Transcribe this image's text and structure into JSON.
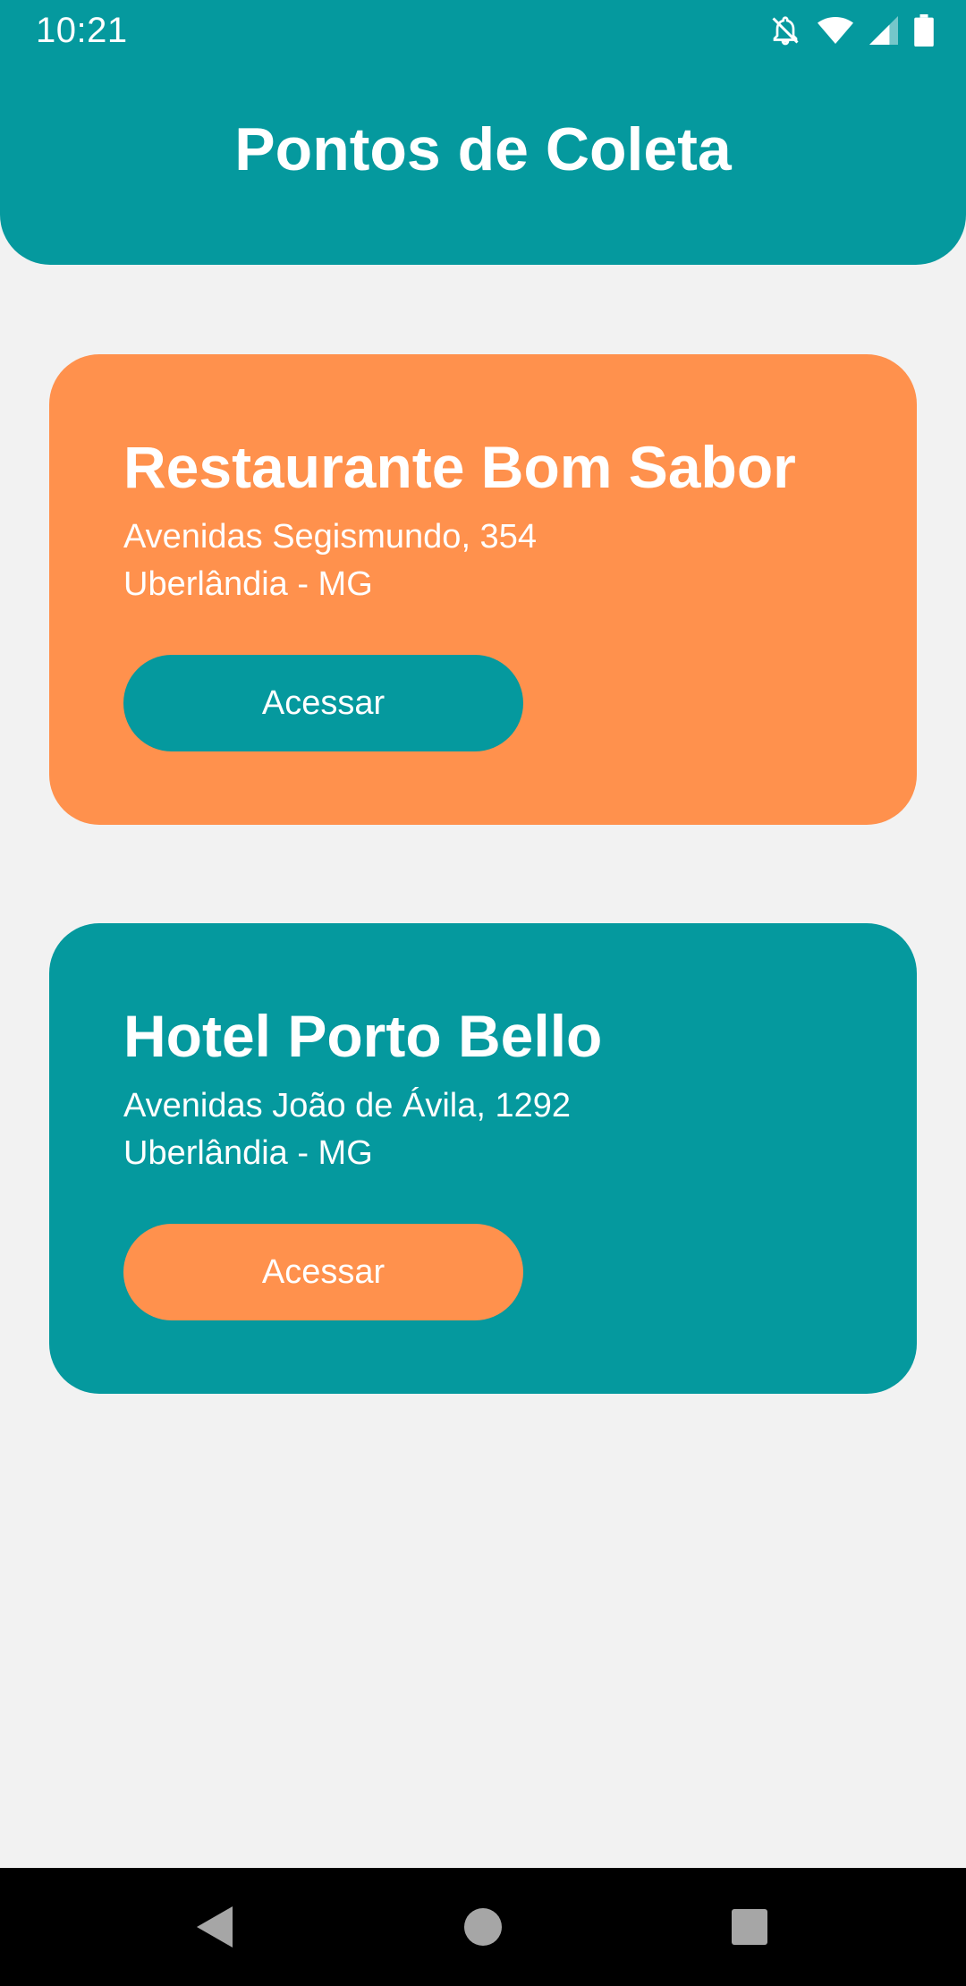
{
  "status_bar": {
    "time": "10:21",
    "icons": [
      "notifications-off-icon",
      "wifi-icon",
      "cellular-signal-icon",
      "battery-icon"
    ]
  },
  "header": {
    "title": "Pontos de Coleta",
    "background_color": "#05999e"
  },
  "collection_points": [
    {
      "name": "Restaurante Bom Sabor",
      "address_line1": "Avenidas Segismundo, 354",
      "address_line2": "Uberlândia - MG",
      "button_label": "Acessar",
      "card_color": "#ff914d",
      "button_color": "#05999e"
    },
    {
      "name": "Hotel Porto Bello",
      "address_line1": "Avenidas João de Ávila, 1292",
      "address_line2": "Uberlândia - MG",
      "button_label": "Acessar",
      "card_color": "#05999e",
      "button_color": "#ff914d"
    }
  ],
  "navigation_bar": {
    "buttons": [
      "back-icon",
      "home-icon",
      "recents-icon"
    ]
  }
}
